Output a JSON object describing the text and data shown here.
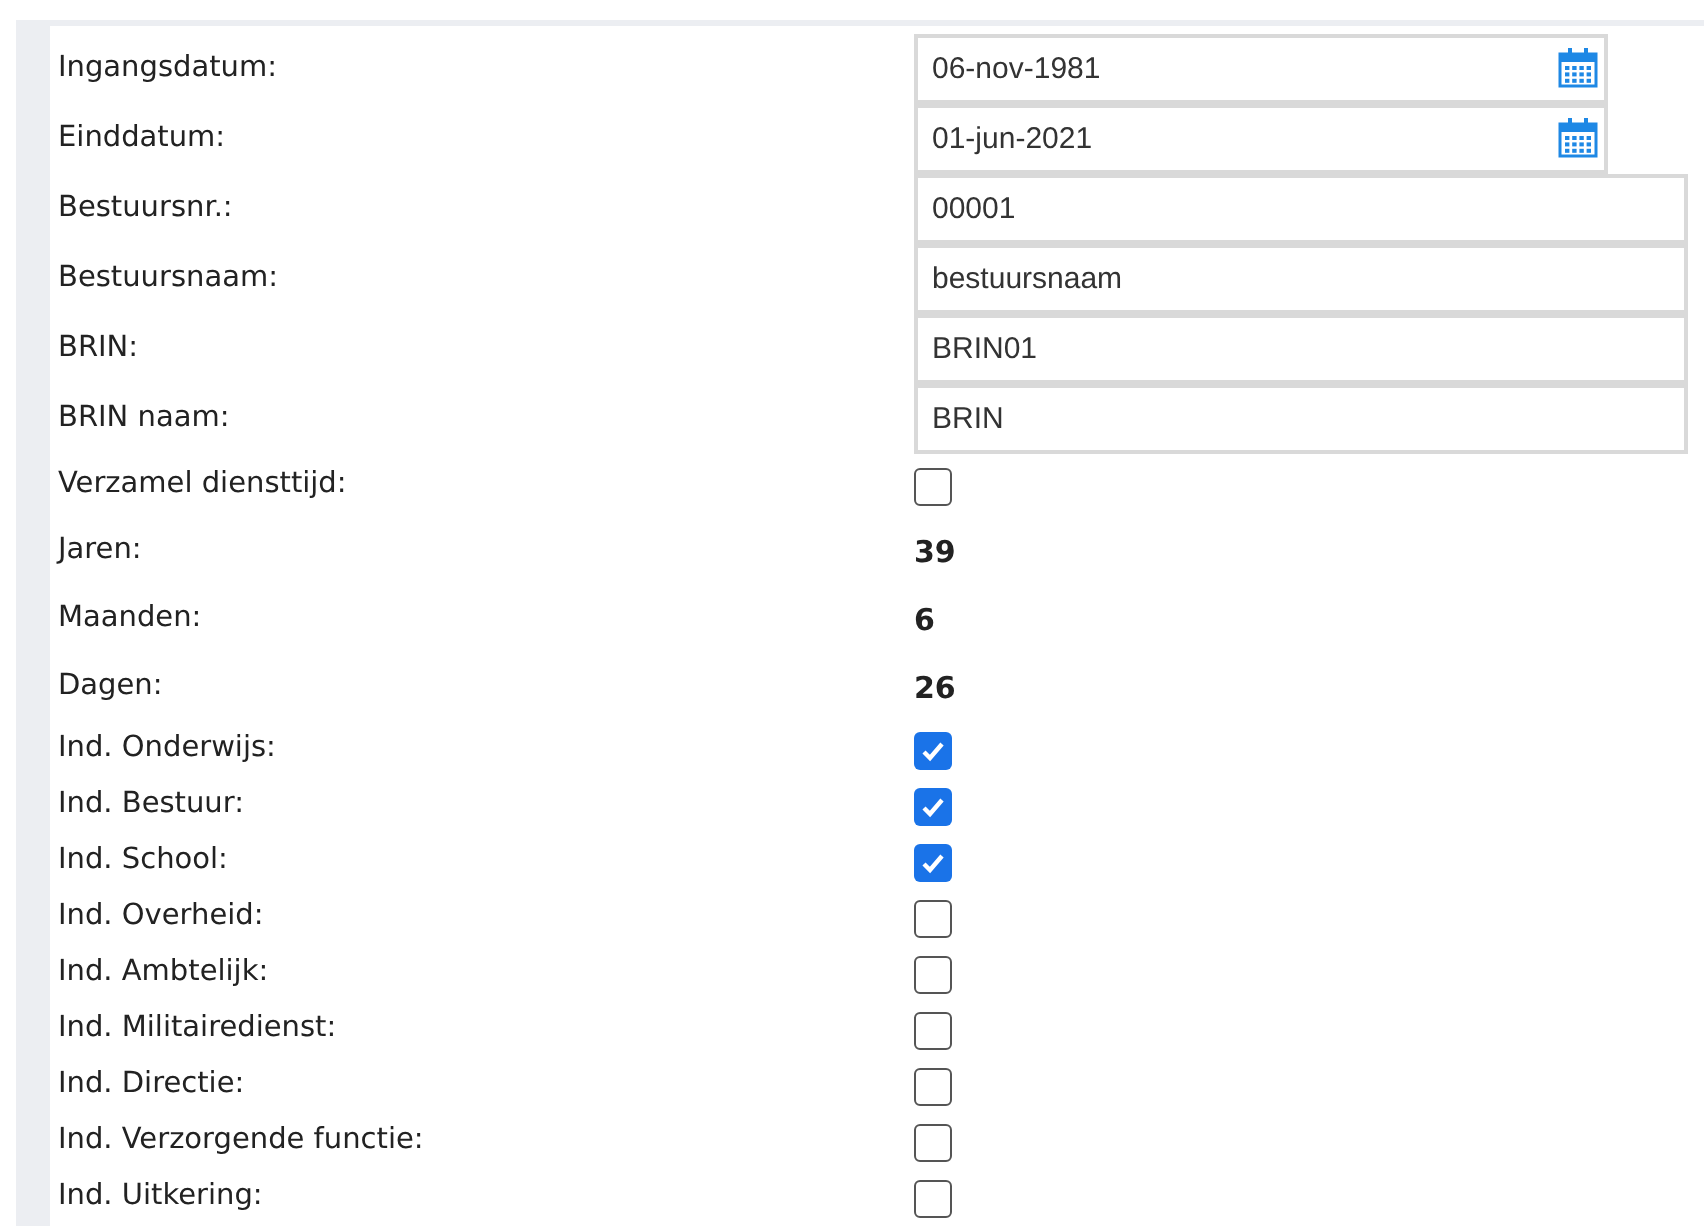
{
  "rows": [
    {
      "kind": "date",
      "label": "Ingangsdatum:",
      "value": "06-nov-1981"
    },
    {
      "kind": "date",
      "label": "Einddatum:",
      "value": "01-jun-2021"
    },
    {
      "kind": "text",
      "label": "Bestuursnr.:",
      "value": "00001"
    },
    {
      "kind": "text",
      "label": "Bestuursnaam:",
      "value": "bestuursnaam"
    },
    {
      "kind": "text",
      "label": "BRIN:",
      "value": "BRIN01"
    },
    {
      "kind": "text",
      "label": "BRIN naam:",
      "value": "BRIN"
    },
    {
      "kind": "checkbox",
      "label": "Verzamel diensttijd:",
      "checked": false
    },
    {
      "kind": "number",
      "label": "Jaren:",
      "value": "39"
    },
    {
      "kind": "number",
      "label": "Maanden:",
      "value": "6"
    },
    {
      "kind": "number",
      "label": "Dagen:",
      "value": "26"
    },
    {
      "kind": "checkbox",
      "label": "Ind. Onderwijs:",
      "checked": true
    },
    {
      "kind": "checkbox",
      "label": "Ind. Bestuur:",
      "checked": true
    },
    {
      "kind": "checkbox",
      "label": "Ind. School:",
      "checked": true
    },
    {
      "kind": "checkbox",
      "label": "Ind. Overheid:",
      "checked": false
    },
    {
      "kind": "checkbox",
      "label": "Ind. Ambtelijk:",
      "checked": false
    },
    {
      "kind": "checkbox",
      "label": "Ind. Militairedienst:",
      "checked": false
    },
    {
      "kind": "checkbox",
      "label": "Ind. Directie:",
      "checked": false
    },
    {
      "kind": "checkbox",
      "label": "Ind. Verzorgende functie:",
      "checked": false
    },
    {
      "kind": "checkbox",
      "label": "Ind. Uitkering:",
      "checked": false
    }
  ]
}
